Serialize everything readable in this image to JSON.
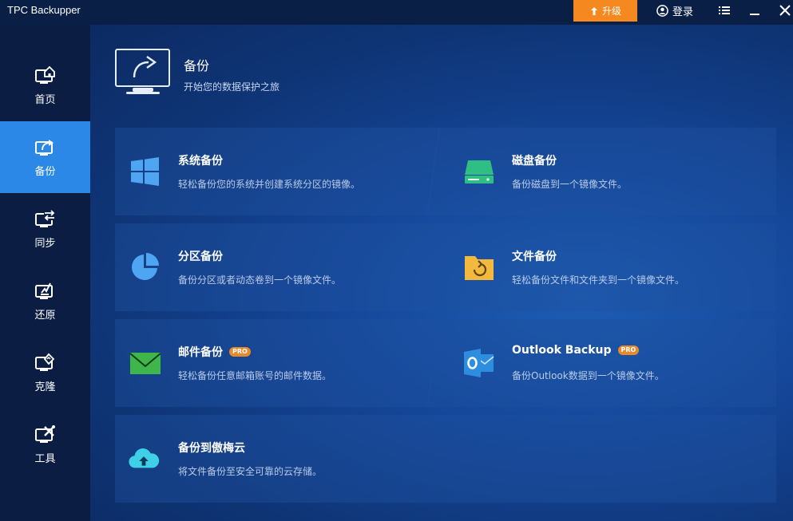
{
  "app": {
    "title": "TPC Backupper"
  },
  "titlebar": {
    "upgrade_label": "升级",
    "login_label": "登录"
  },
  "sidebar": {
    "items": [
      {
        "label": "首页",
        "icon": "home-icon"
      },
      {
        "label": "备份",
        "icon": "backup-icon",
        "active": true
      },
      {
        "label": "同步",
        "icon": "sync-icon"
      },
      {
        "label": "还原",
        "icon": "restore-icon"
      },
      {
        "label": "克隆",
        "icon": "clone-icon"
      },
      {
        "label": "工具",
        "icon": "tools-icon"
      }
    ]
  },
  "header": {
    "title": "备份",
    "subtitle": "开始您的数据保护之旅"
  },
  "cards": [
    {
      "title": "系统备份",
      "desc": "轻松备份您的系统并创建系统分区的镜像。",
      "icon": "windows-icon",
      "pro": false
    },
    {
      "title": "磁盘备份",
      "desc": "备份磁盘到一个镜像文件。",
      "icon": "disk-icon",
      "pro": false
    },
    {
      "title": "分区备份",
      "desc": "备份分区或者动态卷到一个镜像文件。",
      "icon": "pie-chart-icon",
      "pro": false
    },
    {
      "title": "文件备份",
      "desc": "轻松备份文件和文件夹到一个镜像文件。",
      "icon": "folder-refresh-icon",
      "pro": false
    },
    {
      "title": "邮件备份",
      "desc": "轻松备份任意邮箱账号的邮件数据。",
      "icon": "mail-icon",
      "pro": true,
      "badge": "PRO"
    },
    {
      "title": "Outlook Backup",
      "desc": "备份Outlook数据到一个镜像文件。",
      "icon": "outlook-icon",
      "pro": true,
      "badge": "PRO"
    },
    {
      "title": "备份到傲梅云",
      "desc": "将文件备份至安全可靠的云存储。",
      "icon": "cloud-upload-icon",
      "pro": false
    }
  ],
  "colors": {
    "accent": "#2b88e6",
    "upgrade": "#f5891f",
    "pro_badge": "#e78a2b"
  }
}
